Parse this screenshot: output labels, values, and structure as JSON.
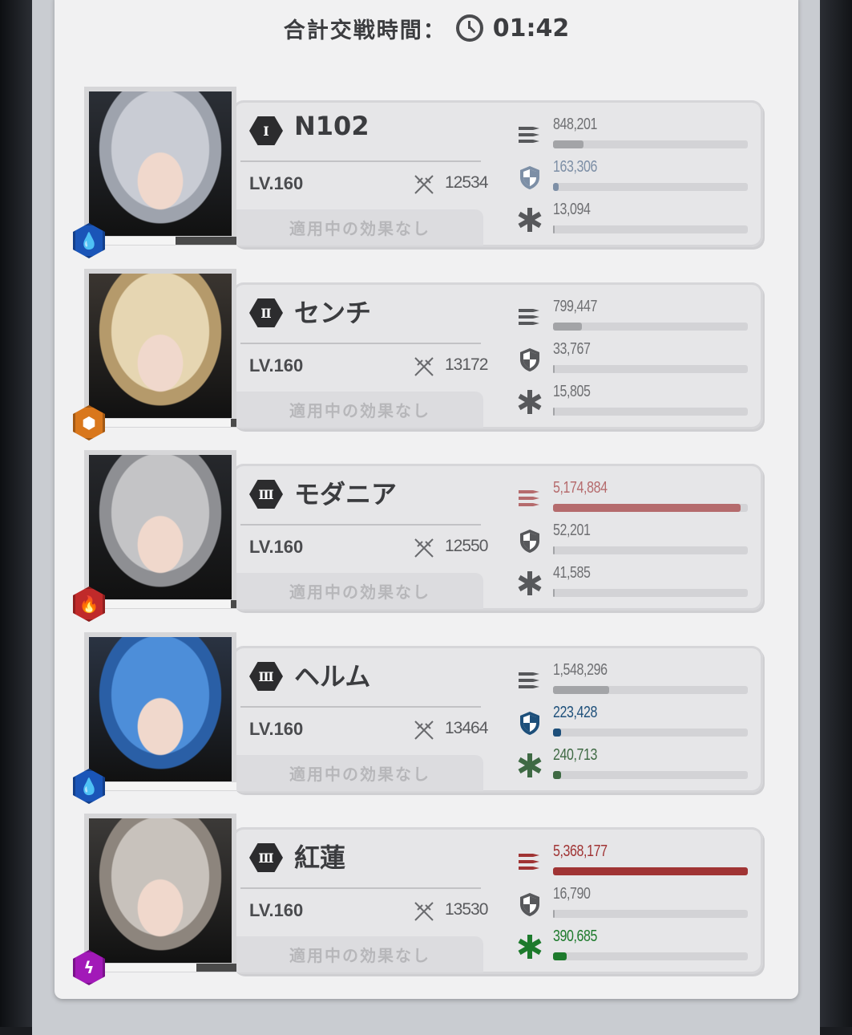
{
  "header": {
    "label": "合計交戦時間：",
    "time": "01:42"
  },
  "effect_text": "適用中の効果なし",
  "colors": {
    "damage_normal": "#a3a4a7",
    "damage_high": "#a03434",
    "damage_mid": "#b56b6d",
    "shield_normal": "#a3a4a7",
    "shield_high": "#1d4f7a",
    "heal_normal": "#a3a4a7",
    "heal_mid": "#3f6a44",
    "heal_high": "#1d7a2c",
    "water": "#1a55b8",
    "wind": "#d9771c",
    "fire": "#c02a2a",
    "electric": "#a219b8"
  },
  "characters": [
    {
      "burst": "Ⅰ",
      "name": "N102",
      "level": "LV.160",
      "power": "12534",
      "element": "water-icon",
      "hp": 0.55,
      "damage": "848,201",
      "damage_ratio": 0.158,
      "damage_color": "#a3a4a7",
      "shield": "163,306",
      "shield_ratio": 0.03,
      "shield_color": "#7d8fa6",
      "heal": "13,094",
      "heal_ratio": 0.005,
      "heal_color": "#a3a4a7"
    },
    {
      "burst": "Ⅱ",
      "name": "センチ",
      "level": "LV.160",
      "power": "13172",
      "element": "wind-icon",
      "hp": 0.96,
      "damage": "799,447",
      "damage_ratio": 0.149,
      "damage_color": "#a3a4a7",
      "shield": "33,767",
      "shield_ratio": 0.006,
      "shield_color": "#a3a4a7",
      "heal": "15,805",
      "heal_ratio": 0.006,
      "heal_color": "#a3a4a7"
    },
    {
      "burst": "Ⅲ",
      "name": "モダニア",
      "level": "LV.160",
      "power": "12550",
      "element": "fire-icon",
      "hp": 0.96,
      "damage": "5,174,884",
      "damage_ratio": 0.964,
      "damage_color": "#b56b6d",
      "shield": "52,201",
      "shield_ratio": 0.007,
      "shield_color": "#a3a4a7",
      "heal": "41,585",
      "heal_ratio": 0.007,
      "heal_color": "#a3a4a7"
    },
    {
      "burst": "Ⅲ",
      "name": "ヘルム",
      "level": "LV.160",
      "power": "13464",
      "element": "water-icon",
      "hp": 1.0,
      "damage": "1,548,296",
      "damage_ratio": 0.288,
      "damage_color": "#a3a4a7",
      "shield": "223,428",
      "shield_ratio": 0.04,
      "shield_color": "#1d4f7a",
      "heal": "240,713",
      "heal_ratio": 0.04,
      "heal_color": "#3f6a44"
    },
    {
      "burst": "Ⅲ",
      "name": "紅蓮",
      "level": "LV.160",
      "power": "13530",
      "element": "electric-icon",
      "hp": 0.7,
      "damage": "5,368,177",
      "damage_ratio": 1.0,
      "damage_color": "#a03434",
      "shield": "16,790",
      "shield_ratio": 0.005,
      "shield_color": "#a3a4a7",
      "heal": "390,685",
      "heal_ratio": 0.07,
      "heal_color": "#1d7a2c"
    }
  ]
}
